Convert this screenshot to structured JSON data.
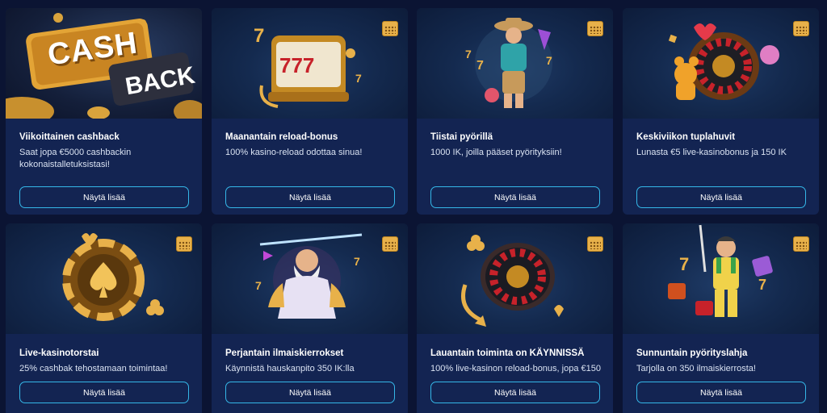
{
  "colors": {
    "card_bg": "#132452",
    "page_bg": "#0b1433",
    "button_border": "#35b7e8",
    "gold": "#e8b14a"
  },
  "cards": [
    {
      "title": "Viikoittainen cashback",
      "desc": "Saat jopa €5000 cashbackin kokonaistalletuksistasi!",
      "button": "Näytä lisää",
      "art_text_1": "CASH",
      "art_text_2": "BACK",
      "icon": "cashback-sign-icon"
    },
    {
      "title": "Maanantain reload-bonus",
      "desc": "100% kasino-reload odottaa sinua!",
      "button": "Näytä lisää",
      "icon": "slot-machine-icon"
    },
    {
      "title": "Tiistai pyörillä",
      "desc": "1000 IK, joilla pääset pyörityksiin!",
      "button": "Näytä lisää",
      "icon": "cowboy-character-icon"
    },
    {
      "title": "Keskiviikon tuplahuvit",
      "desc": "Lunasta €5 live-kasinobonus ja 150 IK",
      "button": "Näytä lisää",
      "icon": "roulette-wheel-icon"
    },
    {
      "title": "Live-kasinotorstai",
      "desc": "25% cashbak tehostamaan toimintaa!",
      "button": "Näytä lisää",
      "icon": "poker-chip-spade-icon"
    },
    {
      "title": "Perjantain ilmaiskierrokset",
      "desc": "Käynnistä hauskanpito 350 IK:lla",
      "button": "Näytä lisää",
      "icon": "zeus-character-icon"
    },
    {
      "title": "Lauantain toiminta on KÄYNNISSÄ",
      "desc": "100% live-kasinon reload-bonus, jopa €150",
      "button": "Näytä lisää",
      "icon": "roulette-wheel-icon"
    },
    {
      "title": "Sunnuntain pyörityslahja",
      "desc": "Tarjolla on 350 ilmaiskierrosta!",
      "button": "Näytä lisää",
      "icon": "miner-character-icon"
    }
  ]
}
